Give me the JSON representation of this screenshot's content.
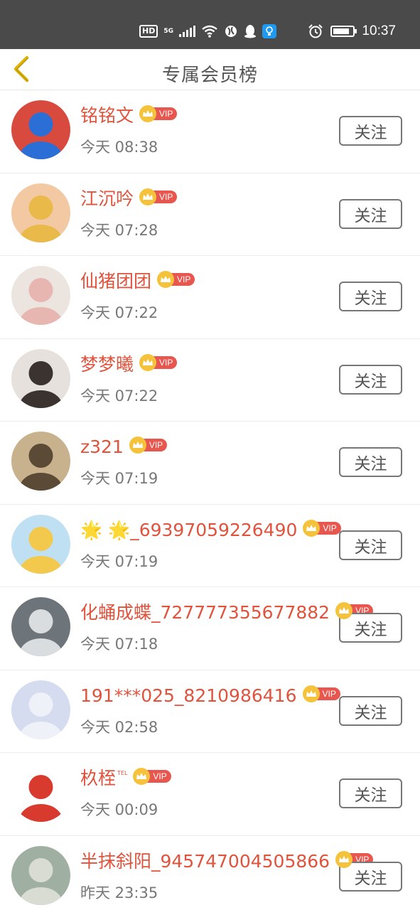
{
  "status_bar": {
    "hd": "HD",
    "network": "5G",
    "time": "10:37",
    "icons": [
      "wifi-icon",
      "globe-icon",
      "qq-icon",
      "bulb-icon",
      "alarm-icon",
      "battery-icon"
    ]
  },
  "header": {
    "title": "专属会员榜",
    "back_icon": "chevron-left-icon",
    "accent": "#e0b400"
  },
  "colors": {
    "name": "#e0533d",
    "vip_tag": "#e8574f",
    "crown": "#f5c33b",
    "time": "#777777"
  },
  "vip_label": "VIP",
  "follow_label": "关注",
  "members": [
    {
      "name": "铭铭文",
      "time": "今天 08:38",
      "tel": "",
      "avatar_bg": "#d94a3e",
      "avatar_fg": "#2b6fd6"
    },
    {
      "name": "江沉吟",
      "time": "今天 07:28",
      "tel": "",
      "avatar_bg": "#f3c9a3",
      "avatar_fg": "#e9b94a"
    },
    {
      "name": "仙猪团团",
      "time": "今天 07:22",
      "tel": "",
      "avatar_bg": "#ece4de",
      "avatar_fg": "#e8b6b0"
    },
    {
      "name": "梦梦曦",
      "time": "今天 07:22",
      "tel": "",
      "avatar_bg": "#e6e1dd",
      "avatar_fg": "#3a3330"
    },
    {
      "name": "z321",
      "time": "今天 07:19",
      "tel": "",
      "avatar_bg": "#c8b28e",
      "avatar_fg": "#5a4a36"
    },
    {
      "name": "🌟 🌟_69397059226490",
      "time": "今天 07:19",
      "tel": "",
      "avatar_bg": "#bfe0f2",
      "avatar_fg": "#f2c94c"
    },
    {
      "name": "化蛹成蝶_727777355677882",
      "time": "今天 07:18",
      "tel": "",
      "avatar_bg": "#6d757a",
      "avatar_fg": "#d9dde0"
    },
    {
      "name": "191***025_8210986416",
      "time": "今天 02:58",
      "tel": "",
      "avatar_bg": "#d5dcef",
      "avatar_fg": "#eef1f8"
    },
    {
      "name": "杦桎",
      "time": "今天 00:09",
      "tel": "TEL",
      "avatar_bg": "#ffffff",
      "avatar_fg": "#d83a2e"
    },
    {
      "name": "半抹斜阳_945747004505866",
      "time": "昨天 23:35",
      "tel": "",
      "avatar_bg": "#9fb0a2",
      "avatar_fg": "#d8dcd3"
    }
  ]
}
